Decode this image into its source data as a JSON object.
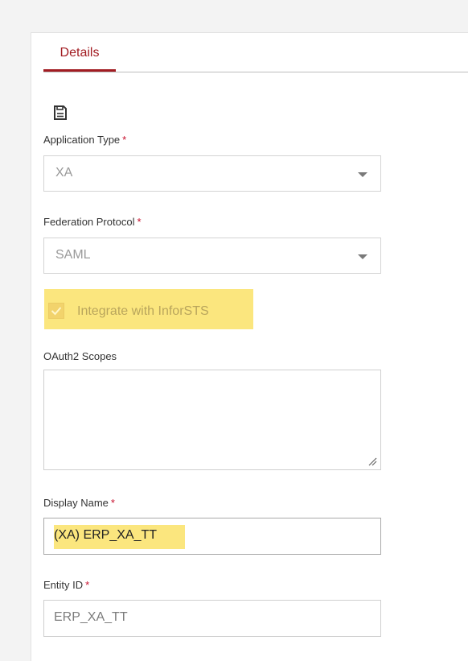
{
  "tabs": {
    "details_label": "Details"
  },
  "toolbar": {
    "save_icon": "save-icon"
  },
  "application_type": {
    "label": "Application Type",
    "required": "*",
    "value": "XA"
  },
  "federation_protocol": {
    "label": "Federation Protocol",
    "required": "*",
    "value": "SAML"
  },
  "integrate": {
    "label": "Integrate with InforSTS",
    "checked": true
  },
  "oauth2_scopes": {
    "label": "OAuth2 Scopes",
    "value": ""
  },
  "display_name": {
    "label": "Display Name",
    "required": "*",
    "value": "(XA) ERP_XA_TT"
  },
  "entity_id": {
    "label": "Entity ID",
    "required": "*",
    "value": "ERP_XA_TT"
  },
  "colors": {
    "accent": "#a21c22",
    "required": "#c8102e",
    "highlight": "#fbe67e"
  }
}
